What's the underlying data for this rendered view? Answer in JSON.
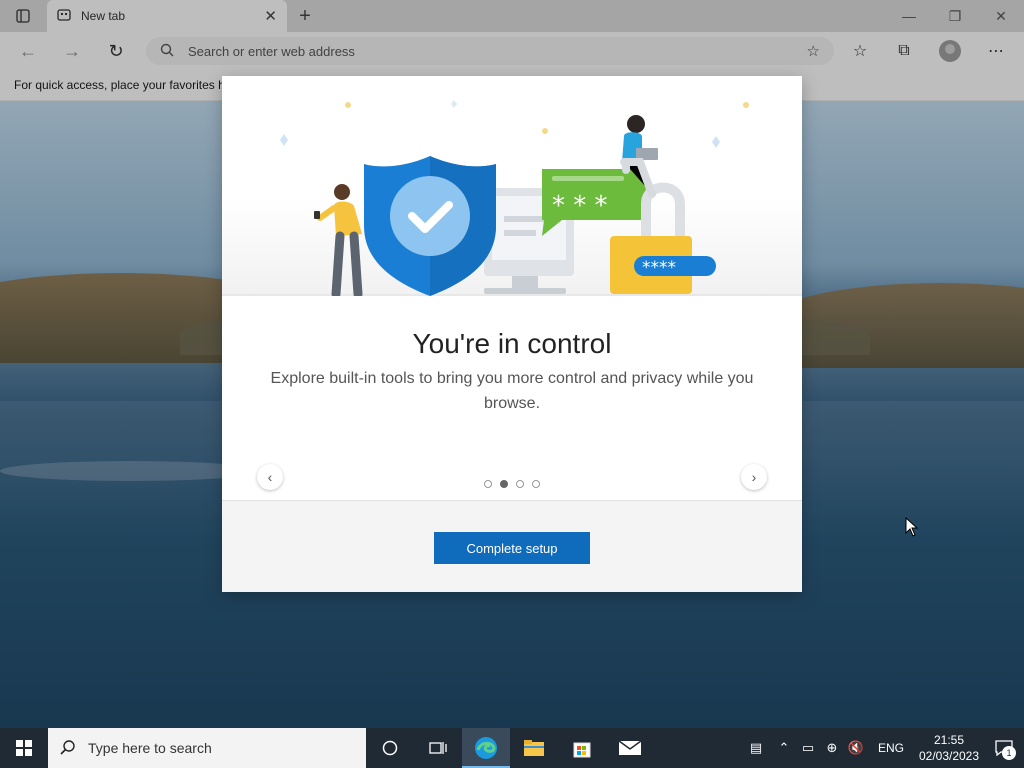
{
  "browser": {
    "tab_title": "New tab",
    "address_placeholder": "Search or enter web address",
    "favorites_bar_text": "For quick access, place your favorites h"
  },
  "modal": {
    "title": "You're in control",
    "description": "Explore built-in tools to bring you more control and privacy while you browse.",
    "complete_button": "Complete setup",
    "carousel": {
      "total_pages": 4,
      "active_page": 2
    },
    "illustration_text": {
      "chat_mask": "* * *",
      "lock_mask": "****"
    }
  },
  "taskbar": {
    "search_placeholder": "Type here to search",
    "language": "ENG",
    "time": "21:55",
    "date": "02/03/2023",
    "notification_count": "1"
  },
  "colors": {
    "accent": "#0f6cbd",
    "taskbar": "#1f2a34",
    "shield": "#1a7fd4",
    "chat": "#6cbb3c",
    "lock": "#f5c338"
  }
}
